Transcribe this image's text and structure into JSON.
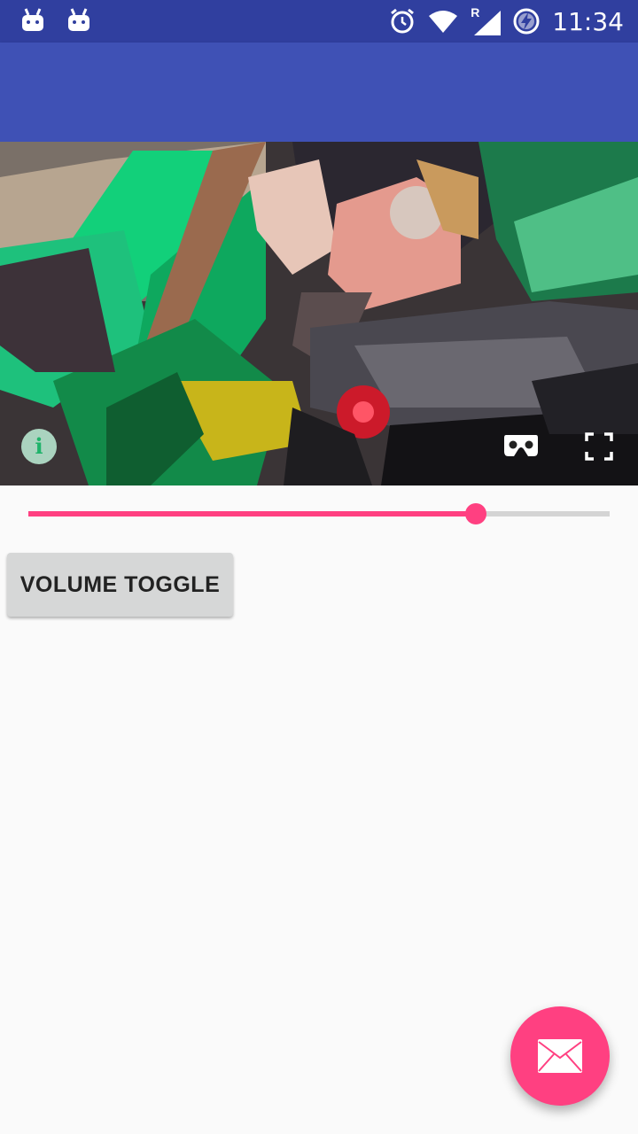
{
  "status_bar": {
    "time": "11:34",
    "left_icons": [
      "android-icon",
      "android-icon"
    ],
    "right_icons": [
      "alarm-icon",
      "wifi-icon",
      "signal-roaming-icon",
      "battery-charging-icon"
    ],
    "roaming_label": "R"
  },
  "theme": {
    "primary_dark": "#303f9f",
    "primary": "#3f51b5",
    "accent": "#ff4081"
  },
  "video": {
    "info_glyph": "i",
    "controls": [
      "info-icon",
      "cardboard-vr-icon",
      "fullscreen-icon"
    ]
  },
  "seek_bar": {
    "progress": 0.77
  },
  "buttons": {
    "volume_toggle": "VOLUME TOGGLE"
  },
  "fab": {
    "icon": "email-icon"
  }
}
